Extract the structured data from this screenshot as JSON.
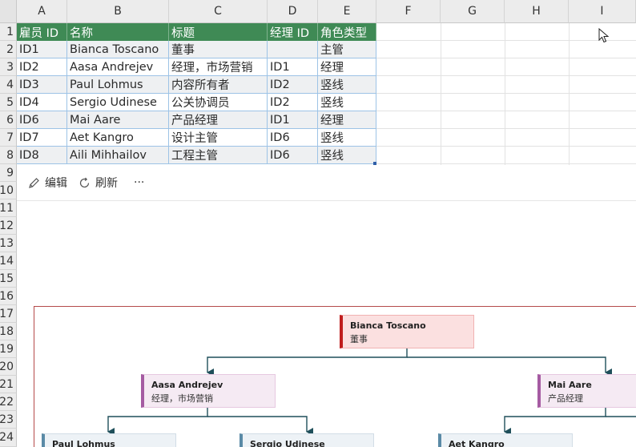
{
  "columns": [
    "A",
    "B",
    "C",
    "D",
    "E",
    "F",
    "G",
    "H",
    "I"
  ],
  "rows": [
    "1",
    "2",
    "3",
    "4",
    "5",
    "6",
    "7",
    "8",
    "9",
    "10",
    "11",
    "12",
    "13",
    "14",
    "15",
    "16",
    "17",
    "18",
    "19",
    "20",
    "21",
    "22",
    "23",
    "24"
  ],
  "table": {
    "headers": [
      "雇员 ID",
      "名称",
      "标题",
      "经理 ID",
      "角色类型"
    ],
    "rows": [
      [
        "ID1",
        "Bianca Toscano",
        "董事",
        "",
        "主管"
      ],
      [
        "ID2",
        "Aasa Andrejev",
        "经理，市场营销",
        "ID1",
        "经理"
      ],
      [
        "ID3",
        "Paul Lohmus",
        "内容所有者",
        "ID2",
        "竖线"
      ],
      [
        "ID4",
        "Sergio Udinese",
        "公关协调员",
        "ID2",
        "竖线"
      ],
      [
        "ID6",
        "Mai Aare",
        "产品经理",
        "ID1",
        "经理"
      ],
      [
        "ID7",
        "Aet Kangro",
        "设计主管",
        "ID6",
        "竖线"
      ],
      [
        "ID8",
        "Aili Mihhailov",
        "工程主管",
        "ID6",
        "竖线"
      ]
    ]
  },
  "toolbar": {
    "edit_label": "编辑",
    "refresh_label": "刷新",
    "more_label": "···"
  },
  "org": {
    "root": {
      "name": "Bianca Toscano",
      "title": "董事"
    },
    "managers": [
      {
        "name": "Aasa Andrejev",
        "title": "经理，市场营销"
      },
      {
        "name": "Mai Aare",
        "title": "产品经理"
      }
    ],
    "leaves": [
      {
        "name": "Paul Lohmus"
      },
      {
        "name": "Sergio Udinese"
      },
      {
        "name": "Aet Kangro"
      }
    ]
  },
  "colors": {
    "header_green": "#3f8a55",
    "root_accent": "#c01e1e",
    "manager_accent": "#a55ba2",
    "leaf_accent": "#5a8aa6",
    "connector": "#1f4f5a"
  }
}
